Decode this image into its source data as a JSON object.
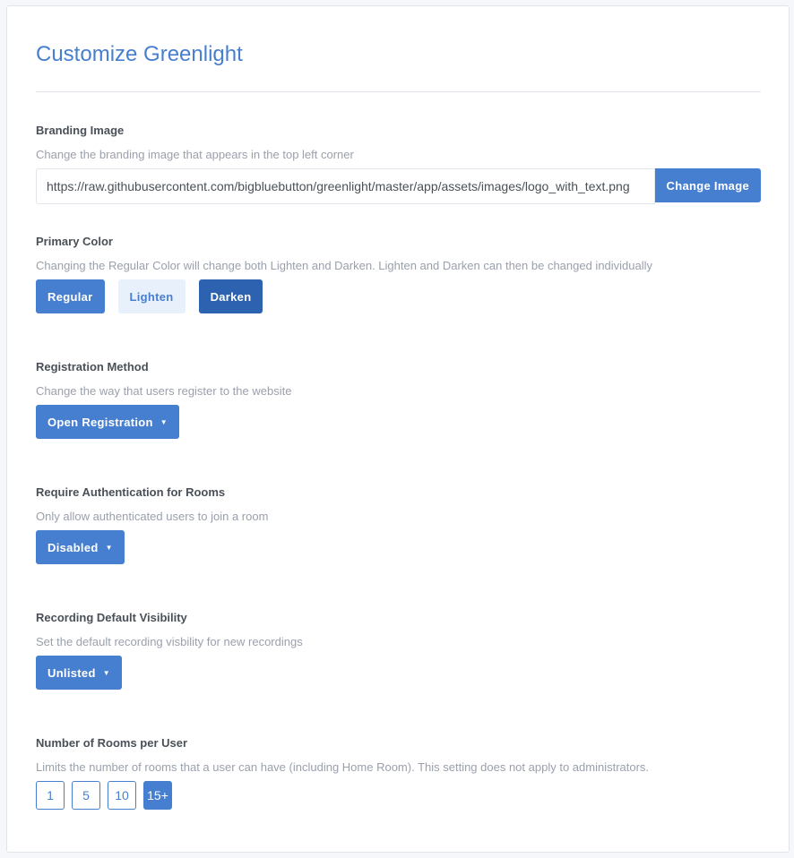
{
  "title": "Customize Greenlight",
  "branding": {
    "label": "Branding Image",
    "desc": "Change the branding image that appears in the top left corner",
    "url": "https://raw.githubusercontent.com/bigbluebutton/greenlight/master/app/assets/images/logo_with_text.png",
    "button": "Change Image"
  },
  "primary": {
    "label": "Primary Color",
    "desc": "Changing the Regular Color will change both Lighten and Darken. Lighten and Darken can then be changed individually",
    "regular": "Regular",
    "lighten": "Lighten",
    "darken": "Darken",
    "colors": {
      "regular": "#467fcf",
      "lighten": "#e8f0fb",
      "darken": "#2d62b0"
    }
  },
  "registration": {
    "label": "Registration Method",
    "desc": "Change the way that users register to the website",
    "value": "Open Registration"
  },
  "auth": {
    "label": "Require Authentication for Rooms",
    "desc": "Only allow authenticated users to join a room",
    "value": "Disabled"
  },
  "recording": {
    "label": "Recording Default Visibility",
    "desc": "Set the default recording visbility for new recordings",
    "value": "Unlisted"
  },
  "rooms": {
    "label": "Number of Rooms per User",
    "desc": "Limits the number of rooms that a user can have (including Home Room). This setting does not apply to administrators.",
    "options": [
      "1",
      "5",
      "10",
      "15+"
    ],
    "selected": "15+"
  }
}
